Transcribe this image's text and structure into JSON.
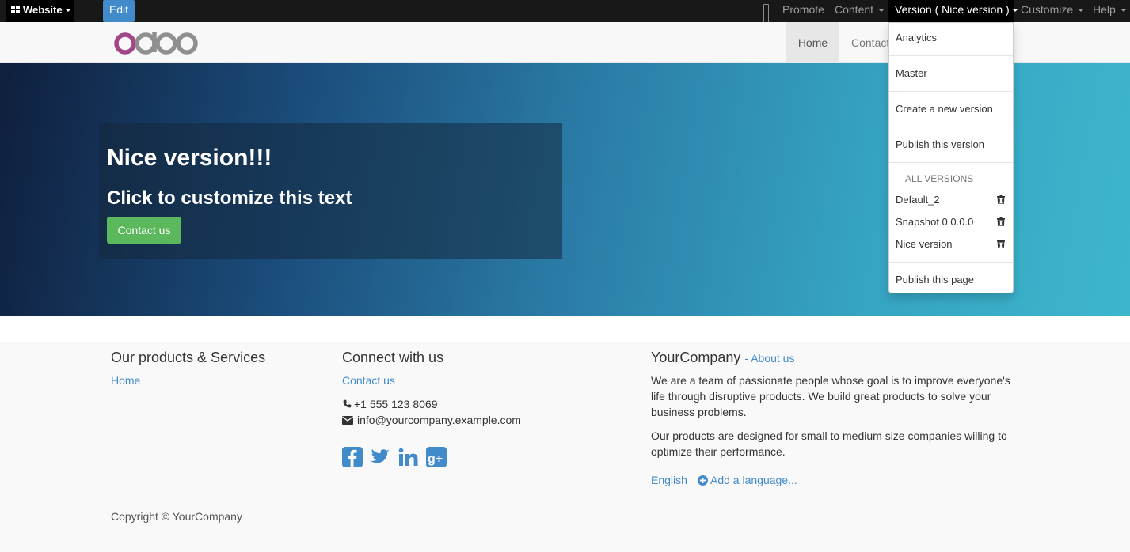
{
  "adminbar": {
    "website_label": "Website",
    "edit_label": "Edit",
    "promote_label": "Promote",
    "content_label": "Content",
    "version_label": "Version ( Nice version )",
    "customize_label": "Customize",
    "help_label": "Help"
  },
  "navbar": {
    "home_label": "Home",
    "contact_label": "Contact"
  },
  "hero": {
    "title": "Nice version!!!",
    "subtitle": "Click to customize this text",
    "button_label": "Contact us"
  },
  "footer": {
    "col1": {
      "heading": "Our products & Services",
      "links": [
        "Home"
      ]
    },
    "col2": {
      "heading": "Connect with us",
      "contact_link": "Contact us",
      "phone": "+1 555 123 8069",
      "email": "info@yourcompany.example.com",
      "social_icons": [
        "facebook-icon",
        "twitter-icon",
        "linkedin-icon",
        "google-plus-icon"
      ]
    },
    "col3": {
      "company": "YourCompany",
      "about_link": "- About us",
      "paragraph1": "We are a team of passionate people whose goal is to improve everyone's life through disruptive products. We build great products to solve your business problems.",
      "paragraph2": "Our products are designed for small to medium size companies willing to optimize their performance.",
      "language": "English",
      "add_language": "Add a language..."
    },
    "copyright": "Copyright © YourCompany"
  },
  "version_dropdown": {
    "analytics": "Analytics",
    "master": "Master",
    "create": "Create a new version",
    "publish_version": "Publish this version",
    "all_versions_header": "ALL VERSIONS",
    "versions": [
      "Default_2",
      "Snapshot 0.0.0.0",
      "Nice version"
    ],
    "publish_page": "Publish this page"
  },
  "colors": {
    "link": "#428bca",
    "button_green": "#5cb85c",
    "admin_bar": "#181818"
  }
}
